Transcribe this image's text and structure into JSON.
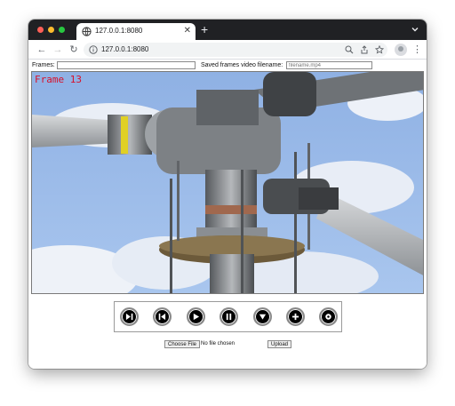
{
  "browser": {
    "tab_title": "127.0.0.1:8080",
    "url": "127.0.0.1:8080",
    "new_tab_icon": "plus-icon",
    "colors": {
      "tabstrip": "#202124",
      "close": "#ff5f57",
      "minimize": "#febc2e",
      "maximize": "#28c840"
    }
  },
  "form": {
    "frames_label": "Frames:",
    "frames_value": "",
    "saved_label": "Saved frames video filename:",
    "filename_placeholder": "filename.mp4"
  },
  "video": {
    "frame_text": "Frame 13",
    "frame_text_color": "#d8102a"
  },
  "controls": [
    {
      "name": "skip-next-icon"
    },
    {
      "name": "skip-previous-icon"
    },
    {
      "name": "play-icon"
    },
    {
      "name": "pause-icon"
    },
    {
      "name": "arrow-down-icon"
    },
    {
      "name": "add-icon"
    },
    {
      "name": "settings-icon"
    }
  ],
  "upload": {
    "choose_label": "Choose File",
    "status": "No file chosen",
    "upload_label": "Upload"
  }
}
